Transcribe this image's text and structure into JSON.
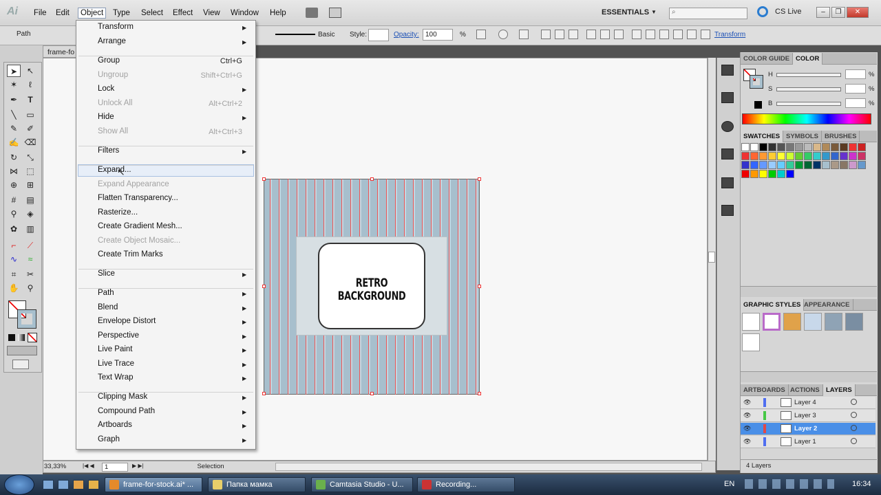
{
  "app": {
    "logo": "Ai"
  },
  "menubar": {
    "items": [
      "File",
      "Edit",
      "Object",
      "Type",
      "Select",
      "Effect",
      "View",
      "Window",
      "Help"
    ],
    "workspace": "ESSENTIALS",
    "cslive": "CS Live"
  },
  "control": {
    "selection": "Path",
    "stroke_style": "Basic",
    "style_label": "Style:",
    "opacity_label": "Opacity:",
    "opacity_value": "100",
    "percent": "%",
    "transform": "Transform"
  },
  "document": {
    "tab": "frame-fo",
    "artwork_title": "RETRO BACKGROUND",
    "zoom": "33,33%",
    "page": "1",
    "tool_status": "Selection"
  },
  "object_menu": {
    "items": [
      {
        "label": "Transform",
        "shortcut": "",
        "sub": true,
        "disabled": false
      },
      {
        "label": "Arrange",
        "shortcut": "",
        "sub": true,
        "disabled": false
      },
      {
        "label": "Group",
        "shortcut": "Ctrl+G",
        "sub": false,
        "disabled": false
      },
      {
        "label": "Ungroup",
        "shortcut": "Shift+Ctrl+G",
        "sub": false,
        "disabled": true
      },
      {
        "label": "Lock",
        "shortcut": "",
        "sub": true,
        "disabled": false
      },
      {
        "label": "Unlock All",
        "shortcut": "Alt+Ctrl+2",
        "sub": false,
        "disabled": true
      },
      {
        "label": "Hide",
        "shortcut": "",
        "sub": true,
        "disabled": false
      },
      {
        "label": "Show All",
        "shortcut": "Alt+Ctrl+3",
        "sub": false,
        "disabled": true
      },
      {
        "label": "Filters",
        "shortcut": "",
        "sub": true,
        "disabled": false
      },
      {
        "label": "Expand...",
        "shortcut": "",
        "sub": false,
        "disabled": false,
        "highlighted": true
      },
      {
        "label": "Expand Appearance",
        "shortcut": "",
        "sub": false,
        "disabled": true
      },
      {
        "label": "Flatten Transparency...",
        "shortcut": "",
        "sub": false,
        "disabled": false
      },
      {
        "label": "Rasterize...",
        "shortcut": "",
        "sub": false,
        "disabled": false
      },
      {
        "label": "Create Gradient Mesh...",
        "shortcut": "",
        "sub": false,
        "disabled": false
      },
      {
        "label": "Create Object Mosaic...",
        "shortcut": "",
        "sub": false,
        "disabled": true
      },
      {
        "label": "Create Trim Marks",
        "shortcut": "",
        "sub": false,
        "disabled": false
      },
      {
        "label": "Slice",
        "shortcut": "",
        "sub": true,
        "disabled": false
      },
      {
        "label": "Path",
        "shortcut": "",
        "sub": true,
        "disabled": false
      },
      {
        "label": "Blend",
        "shortcut": "",
        "sub": true,
        "disabled": false
      },
      {
        "label": "Envelope Distort",
        "shortcut": "",
        "sub": true,
        "disabled": false
      },
      {
        "label": "Perspective",
        "shortcut": "",
        "sub": true,
        "disabled": false
      },
      {
        "label": "Live Paint",
        "shortcut": "",
        "sub": true,
        "disabled": false
      },
      {
        "label": "Live Trace",
        "shortcut": "",
        "sub": true,
        "disabled": false
      },
      {
        "label": "Text Wrap",
        "shortcut": "",
        "sub": true,
        "disabled": false
      },
      {
        "label": "Clipping Mask",
        "shortcut": "",
        "sub": true,
        "disabled": false
      },
      {
        "label": "Compound Path",
        "shortcut": "",
        "sub": true,
        "disabled": false
      },
      {
        "label": "Artboards",
        "shortcut": "",
        "sub": true,
        "disabled": false
      },
      {
        "label": "Graph",
        "shortcut": "",
        "sub": true,
        "disabled": false
      }
    ]
  },
  "color_panel": {
    "tabs": [
      "COLOR GUIDE",
      "COLOR"
    ],
    "channels": [
      "H",
      "S",
      "B"
    ],
    "unit": "%"
  },
  "swatches_panel": {
    "tabs": [
      "SWATCHES",
      "SYMBOLS",
      "BRUSHES"
    ]
  },
  "styles_panel": {
    "tabs": [
      "GRAPHIC STYLES",
      "APPEARANCE"
    ]
  },
  "layers_panel": {
    "tabs": [
      "ARTBOARDS",
      "ACTIONS",
      "LAYERS"
    ],
    "layers": [
      {
        "name": "Layer 4",
        "color": "#4f6ef0",
        "selected": false
      },
      {
        "name": "Layer 3",
        "color": "#46c846",
        "selected": false
      },
      {
        "name": "Layer 2",
        "color": "#e04848",
        "selected": true
      },
      {
        "name": "Layer 1",
        "color": "#4f6ef0",
        "selected": false
      }
    ],
    "count": "4 Layers"
  },
  "taskbar": {
    "buttons": [
      "frame-for-stock.ai* ...",
      "Папка мамка",
      "Camtasia Studio - U...",
      "Recording..."
    ],
    "lang": "EN",
    "time": "16:34"
  },
  "colors": {
    "accent": "#4a8fe7",
    "artboard_stripe": "#a7bfcd",
    "guide_red": "#e55555"
  }
}
